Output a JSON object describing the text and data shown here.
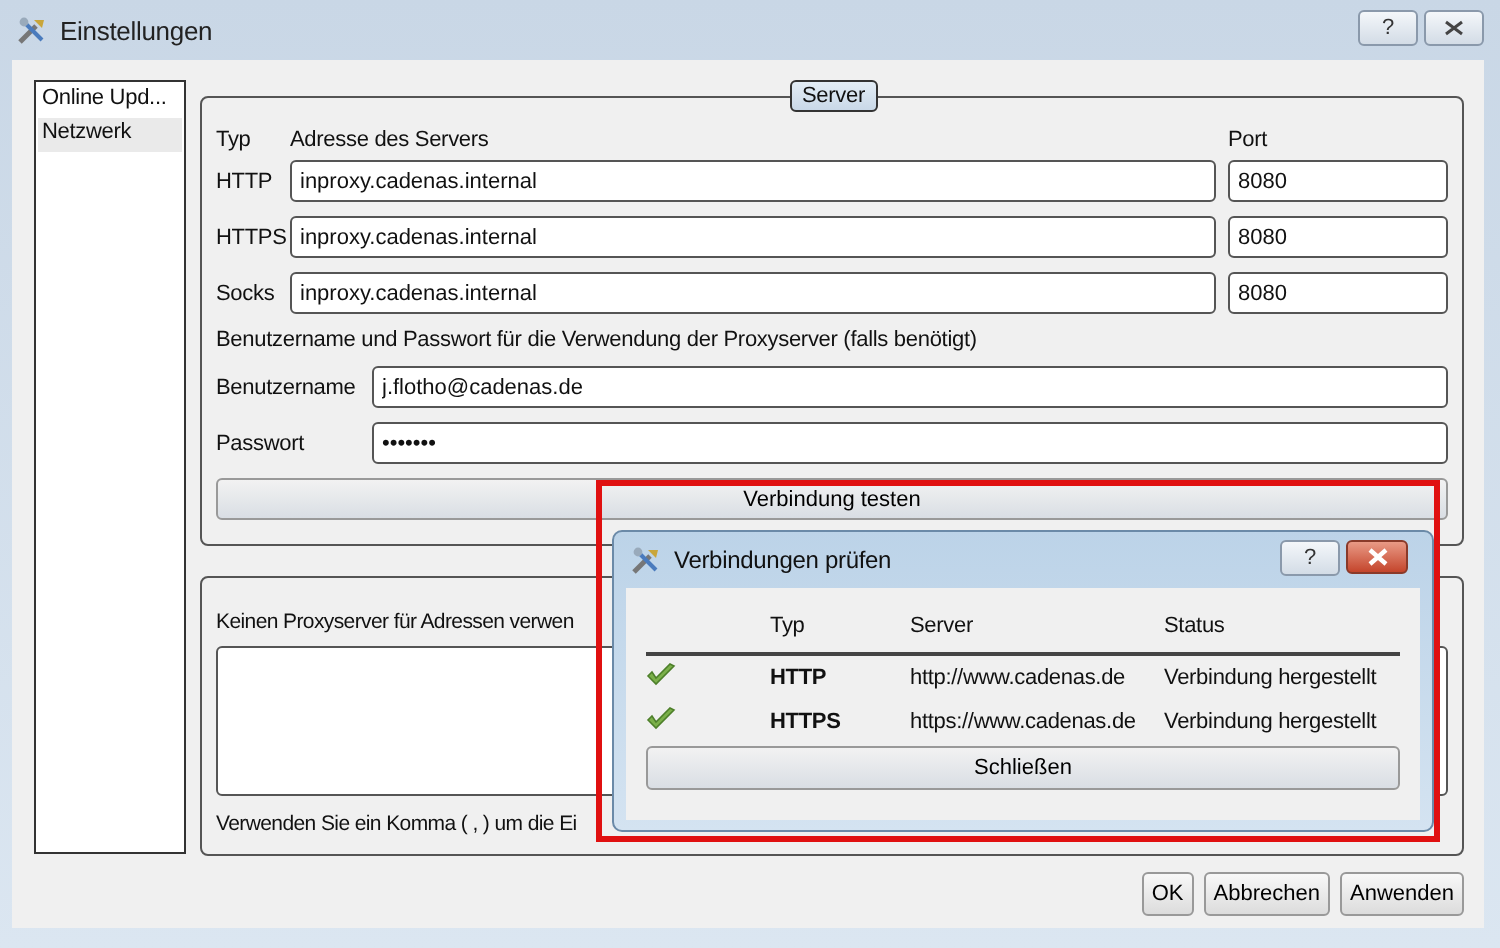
{
  "window": {
    "title": "Einstellungen",
    "help": "?"
  },
  "sidebar": {
    "items": [
      {
        "label": "Online Upd...",
        "selected": false
      },
      {
        "label": "Netzwerk",
        "selected": true
      }
    ]
  },
  "server_group": {
    "title": "Server",
    "header": {
      "type": "Typ",
      "address": "Adresse des Servers",
      "port": "Port"
    },
    "proxies": [
      {
        "type": "HTTP",
        "address": "inproxy.cadenas.internal",
        "port": "8080"
      },
      {
        "type": "HTTPS",
        "address": "inproxy.cadenas.internal",
        "port": "8080"
      },
      {
        "type": "Socks",
        "address": "inproxy.cadenas.internal",
        "port": "8080"
      }
    ],
    "credentials_note": "Benutzername und Passwort für die Verwendung der Proxyserver (falls benötigt)",
    "username": {
      "label": "Benutzername",
      "value": "j.flotho@cadenas.de"
    },
    "password": {
      "label": "Passwort",
      "value": "•••••••"
    },
    "test_button": "Verbindung testen"
  },
  "exceptions_group": {
    "label": "Keinen Proxyserver für Adressen verwen",
    "hint": "Verwenden Sie ein Komma ( , ) um die Ei"
  },
  "buttons": [
    "OK",
    "Abbrechen",
    "Anwenden"
  ],
  "dialog": {
    "title": "Verbindungen prüfen",
    "help": "?",
    "columns": [
      "Typ",
      "Server",
      "Status"
    ],
    "rows": [
      {
        "type": "HTTP",
        "server": "http://www.cadenas.de",
        "status": "Verbindung hergestellt"
      },
      {
        "type": "HTTPS",
        "server": "https://www.cadenas.de",
        "status": "Verbindung hergestellt"
      }
    ],
    "close_button": "Schließen"
  }
}
